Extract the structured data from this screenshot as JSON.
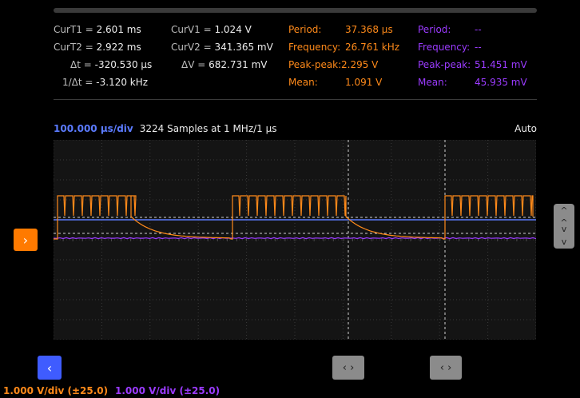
{
  "cursors": {
    "curT1": {
      "label": "CurT1 =",
      "value": "2.601 ms"
    },
    "curT2": {
      "label": "CurT2 =",
      "value": "2.922 ms"
    },
    "dt": {
      "label": "Δt =",
      "value": "-320.530 μs"
    },
    "inv_dt": {
      "label": "1/Δt =",
      "value": "-3.120 kHz"
    },
    "curV1": {
      "label": "CurV1 =",
      "value": "1.024 V"
    },
    "curV2": {
      "label": "CurV2 =",
      "value": "341.365 mV"
    },
    "dv": {
      "label": "ΔV =",
      "value": "682.731 mV"
    }
  },
  "measure_ch1": {
    "period": {
      "label": "Period:",
      "value": "37.368 μs"
    },
    "frequency": {
      "label": "Frequency:",
      "value": "26.761 kHz"
    },
    "peak_peak": {
      "label": "Peak-peak:",
      "value": "2.295 V"
    },
    "mean": {
      "label": "Mean:",
      "value": "1.091 V"
    }
  },
  "measure_ch2": {
    "period": {
      "label": "Period:",
      "value": "--"
    },
    "frequency": {
      "label": "Frequency:",
      "value": "--"
    },
    "peak_peak": {
      "label": "Peak-peak:",
      "value": "51.451 mV"
    },
    "mean": {
      "label": "Mean:",
      "value": "45.935 mV"
    }
  },
  "timebase": {
    "per_div": "100.000 μs/div",
    "samples": "3224 Samples at 1 MHz/1 μs",
    "trigger_mode": "Auto"
  },
  "channels": {
    "ch1": {
      "scale": "1.000 V/div (±25.0)",
      "color": "#ff8a1a"
    },
    "ch2": {
      "scale": "1.000 V/div (±25.0)",
      "color": "#9b3bff"
    }
  },
  "buttons": {
    "channel_arrow": "›",
    "scroll_left": "‹",
    "cursor1": "‹ ›",
    "cursor2": "‹ ›",
    "v_up": "^",
    "v_down": "v"
  },
  "icons": {
    "channel_arrow": "chevron-right-icon",
    "scroll_left": "chevron-left-icon",
    "cursor_handle": "chevron-left-right-icon",
    "vertical_handle": "chevron-up-down-icon"
  },
  "colors": {
    "accent_blue": "#3f5cff",
    "ch1_orange": "#ff8a1a",
    "ch2_purple": "#9b3bff",
    "cursor_blue": "#5b7bff",
    "handle_grey": "#8b8b8b"
  }
}
